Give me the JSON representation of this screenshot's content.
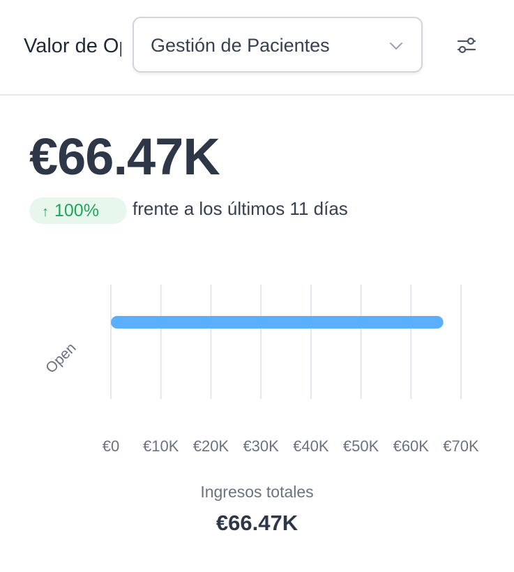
{
  "header": {
    "title": "Valor de Oportunidades",
    "select": {
      "value": "Gestión de Pacientes",
      "chevron_icon": "chevron-down-icon"
    },
    "filter_icon": "sliders-icon"
  },
  "kpi": {
    "value": "€66.47K",
    "change": "100%",
    "change_direction": "up",
    "change_color": "#22a45d",
    "comparison": "frente a los últimos 11 días"
  },
  "chart_data": {
    "type": "bar",
    "orientation": "horizontal",
    "categories": [
      "Open"
    ],
    "values": [
      66470
    ],
    "xlim": [
      0,
      70000
    ],
    "xticks": [
      0,
      10000,
      20000,
      30000,
      40000,
      50000,
      60000,
      70000
    ],
    "xtick_labels": [
      "€0",
      "€10K",
      "€20K",
      "€30K",
      "€40K",
      "€50K",
      "€60K",
      "€70K"
    ],
    "grid": true,
    "bar_color": "#5aafff"
  },
  "total": {
    "label": "Ingresos totales",
    "value": "€66.47K"
  }
}
